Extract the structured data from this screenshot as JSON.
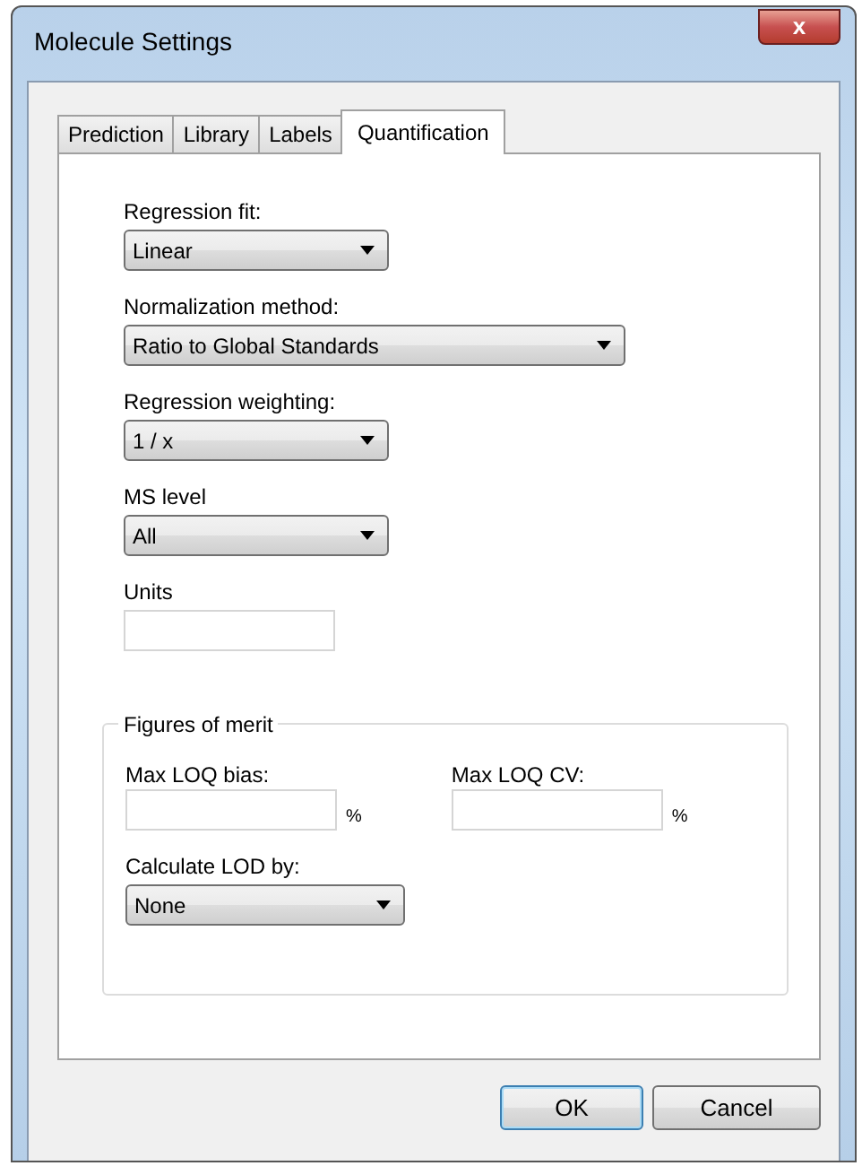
{
  "window": {
    "title": "Molecule Settings",
    "close": "x"
  },
  "tabs": [
    {
      "label": "Prediction",
      "selected": false
    },
    {
      "label": "Library",
      "selected": false
    },
    {
      "label": "Labels",
      "selected": false
    },
    {
      "label": "Quantification",
      "selected": true
    }
  ],
  "fields": [
    {
      "label": "Regression fit:",
      "kind": "dropdown",
      "value": "Linear"
    },
    {
      "label": "Normalization method:",
      "kind": "dropdown",
      "value": "Ratio to Global Standards"
    },
    {
      "label": "Regression weighting:",
      "kind": "dropdown",
      "value": "1 / x"
    },
    {
      "label": "MS level",
      "kind": "dropdown",
      "value": "All"
    },
    {
      "label": "Units",
      "kind": "text"
    }
  ],
  "figures_of_merit": {
    "title": "Figures of merit",
    "limits": [
      {
        "label": "Max LOQ bias:",
        "unit": "%"
      },
      {
        "label": "Max LOQ CV:",
        "unit": "%"
      }
    ],
    "lod": {
      "label": "Calculate LOD by:",
      "value": "None"
    }
  },
  "buttons": [
    {
      "label": "OK",
      "default": true
    },
    {
      "label": "Cancel",
      "default": false
    }
  ]
}
